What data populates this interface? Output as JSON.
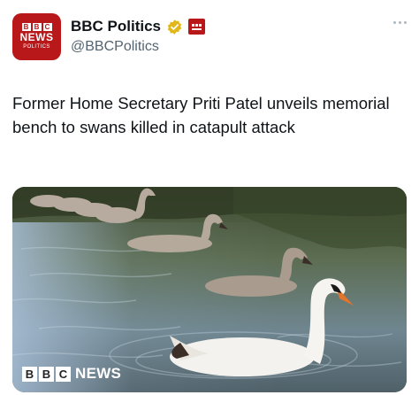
{
  "account": {
    "avatar": {
      "bbc_letters": [
        "B",
        "B",
        "C"
      ],
      "news_text": "NEWS",
      "sub_text": "POLITICS"
    },
    "display_name": "BBC Politics",
    "handle": "@BBCPolitics",
    "verified": true
  },
  "icons": {
    "verified": "gold-verified-badge-icon",
    "affiliate": "bbc-affiliate-badge-icon",
    "more": "more-options-icon"
  },
  "tweet": {
    "text": "Former Home Secretary Priti Patel unveils memorial bench to swans killed in catapult attack"
  },
  "media": {
    "description_alt": "swans-on-pond-photo",
    "logo": {
      "letters": [
        "B",
        "B",
        "C"
      ],
      "word": "NEWS"
    }
  },
  "colors": {
    "brand_red": "#b8181a",
    "verified_gold": "#e2b719",
    "text_primary": "#0f1419",
    "text_secondary": "#536471"
  }
}
